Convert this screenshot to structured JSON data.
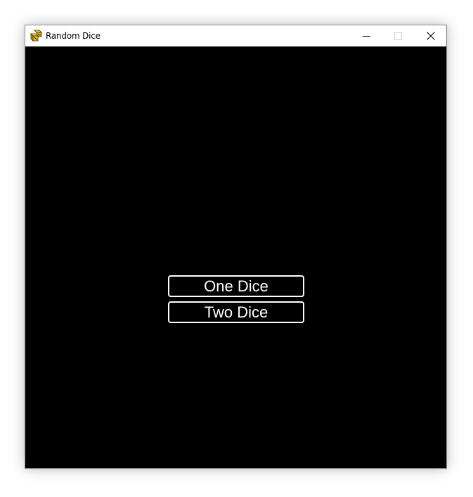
{
  "window": {
    "title": "Random Dice",
    "icon": "dice-app-icon",
    "controls": {
      "minimize_icon": "minimize-icon",
      "maximize_icon": "maximize-icon",
      "close_icon": "close-icon"
    }
  },
  "menu": {
    "buttons": [
      {
        "label": "One Dice"
      },
      {
        "label": "Two Dice"
      }
    ]
  },
  "colors": {
    "background": "#000000",
    "button_border": "#ffffff",
    "button_text": "#ffffff",
    "titlebar": "#ffffff"
  }
}
